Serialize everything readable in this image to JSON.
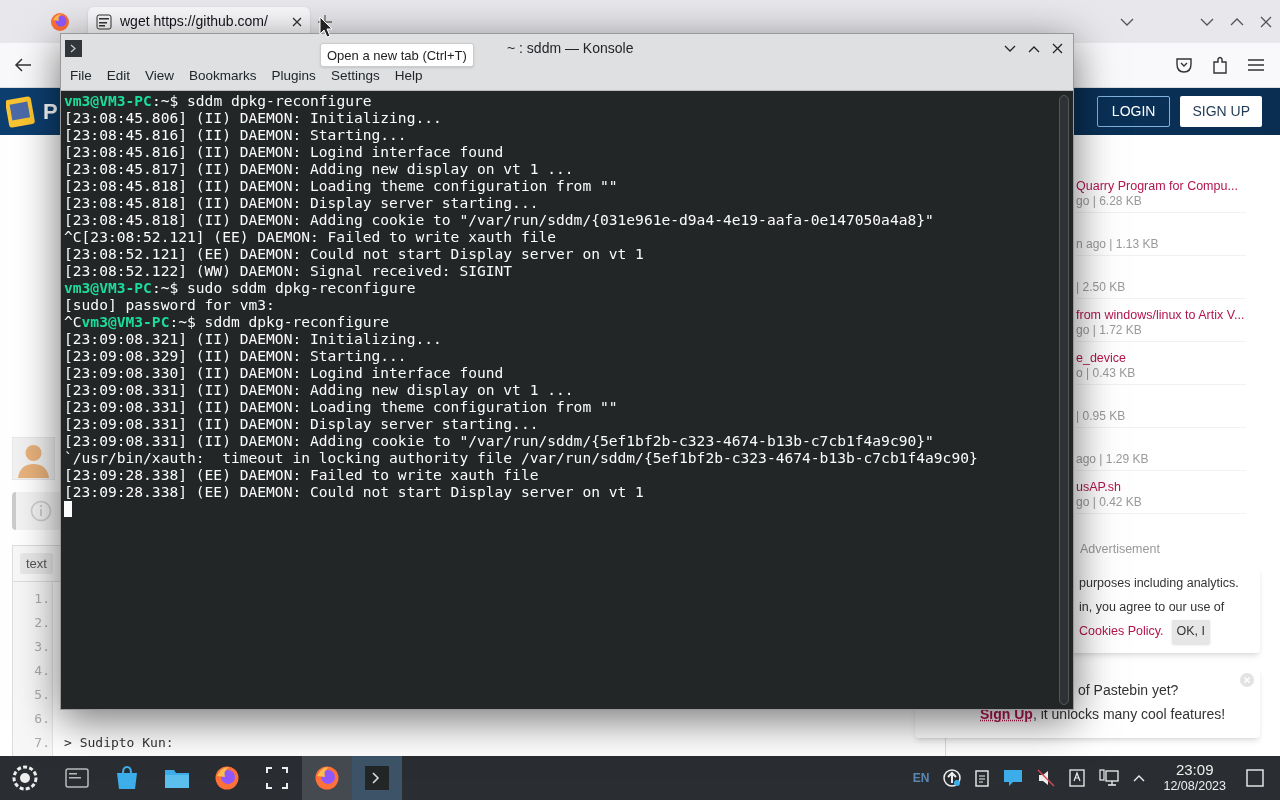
{
  "browser": {
    "tab": {
      "title": "wget https://github.com/"
    },
    "tooltip": "Open a new tab (Ctrl+T)",
    "page": {
      "logo_text": "P",
      "login": "LOGIN",
      "signup": "SIGN UP",
      "recent": [
        {
          "title": "Quarry Program for Compu...",
          "meta": "go | 6.28 KB"
        },
        {
          "meta": "n ago | 1.13 KB"
        },
        {
          "meta": "| 2.50 KB"
        },
        {
          "title": "from windows/linux to Artix V...",
          "meta": "go | 1.72 KB"
        },
        {
          "title": "e_device",
          "meta": "o | 0.43 KB"
        },
        {
          "meta": "| 0.95 KB"
        },
        {
          "meta": "ago | 1.29 KB"
        },
        {
          "title": "usAP.sh",
          "meta": "go | 0.42 KB"
        }
      ],
      "advertisement": "Advertisement",
      "cookie": {
        "lines": [
          "purposes including analytics.",
          "in, you agree to our use of"
        ],
        "link": "Cookies Policy.",
        "button": "OK, I"
      },
      "signup_prompt": {
        "line1": "of Pastebin yet?",
        "link": "Sign Up",
        "rest": ", it unlocks many cool features!"
      },
      "paste": {
        "syntax": "text",
        "line_numbers": [
          "1.",
          "2.",
          "3.",
          "4.",
          "5.",
          "6.",
          "7."
        ],
        "code_line": "> Sudipto Kun:"
      }
    }
  },
  "konsole": {
    "title": "~ : sddm — Konsole",
    "menu": [
      "File",
      "Edit",
      "View",
      "Bookmarks",
      "Plugins",
      "Settings",
      "Help"
    ],
    "lines": [
      {
        "kind": "prompt",
        "prompt": "vm3@VM3-PC",
        "sym": ":~$",
        "cmd": " sddm dpkg-reconfigure"
      },
      {
        "kind": "output",
        "text": "[23:08:45.806] (II) DAEMON: Initializing..."
      },
      {
        "kind": "output",
        "text": "[23:08:45.816] (II) DAEMON: Starting..."
      },
      {
        "kind": "output",
        "text": "[23:08:45.816] (II) DAEMON: Logind interface found"
      },
      {
        "kind": "output",
        "text": "[23:08:45.817] (II) DAEMON: Adding new display on vt 1 ..."
      },
      {
        "kind": "output",
        "text": "[23:08:45.818] (II) DAEMON: Loading theme configuration from \"\""
      },
      {
        "kind": "output",
        "text": "[23:08:45.818] (II) DAEMON: Display server starting..."
      },
      {
        "kind": "output",
        "text": "[23:08:45.818] (II) DAEMON: Adding cookie to \"/var/run/sddm/{031e961e-d9a4-4e19-aafa-0e147050a4a8}\""
      },
      {
        "kind": "output",
        "text": "^C[23:08:52.121] (EE) DAEMON: Failed to write xauth file"
      },
      {
        "kind": "output",
        "text": "[23:08:52.121] (EE) DAEMON: Could not start Display server on vt 1"
      },
      {
        "kind": "output",
        "text": "[23:08:52.122] (WW) DAEMON: Signal received: SIGINT"
      },
      {
        "kind": "prompt",
        "prompt": "vm3@VM3-PC",
        "sym": ":~$",
        "cmd": " sudo sddm dpkg-reconfigure"
      },
      {
        "kind": "output",
        "text": "[sudo] password for vm3:"
      },
      {
        "kind": "prompt",
        "pre": "^C",
        "prompt": "vm3@VM3-PC",
        "sym": ":~$",
        "cmd": " sddm dpkg-reconfigure"
      },
      {
        "kind": "output",
        "text": "[23:09:08.321] (II) DAEMON: Initializing..."
      },
      {
        "kind": "output",
        "text": "[23:09:08.329] (II) DAEMON: Starting..."
      },
      {
        "kind": "output",
        "text": "[23:09:08.330] (II) DAEMON: Logind interface found"
      },
      {
        "kind": "output",
        "text": "[23:09:08.331] (II) DAEMON: Adding new display on vt 1 ..."
      },
      {
        "kind": "output",
        "text": "[23:09:08.331] (II) DAEMON: Loading theme configuration from \"\""
      },
      {
        "kind": "output",
        "text": "[23:09:08.331] (II) DAEMON: Display server starting..."
      },
      {
        "kind": "output",
        "text": "[23:09:08.331] (II) DAEMON: Adding cookie to \"/var/run/sddm/{5ef1bf2b-c323-4674-b13b-c7cb1f4a9c90}\""
      },
      {
        "kind": "output",
        "text": "`/usr/bin/xauth:  timeout in locking authority file /var/run/sddm/{5ef1bf2b-c323-4674-b13b-c7cb1f4a9c90}"
      },
      {
        "kind": "output",
        "text": "[23:09:28.338] (EE) DAEMON: Failed to write xauth file"
      },
      {
        "kind": "output",
        "text": "[23:09:28.338] (EE) DAEMON: Could not start Display server on vt 1"
      },
      {
        "kind": "cursor"
      }
    ]
  },
  "taskbar": {
    "apps": [
      {
        "kind": "launcher",
        "open": false,
        "selected": false
      },
      {
        "kind": "overview",
        "open": false,
        "selected": false
      },
      {
        "kind": "store",
        "open": false,
        "selected": false
      },
      {
        "kind": "folder",
        "open": false,
        "selected": false
      },
      {
        "kind": "browser",
        "open": false,
        "selected": false
      },
      {
        "kind": "screenshot",
        "open": false,
        "selected": false
      },
      {
        "kind": "browser",
        "open": true,
        "selected": false
      },
      {
        "kind": "terminal",
        "open": true,
        "selected": true
      }
    ],
    "tray": {
      "language": "EN",
      "time": "23:09",
      "date": "12/08/2023"
    }
  }
}
